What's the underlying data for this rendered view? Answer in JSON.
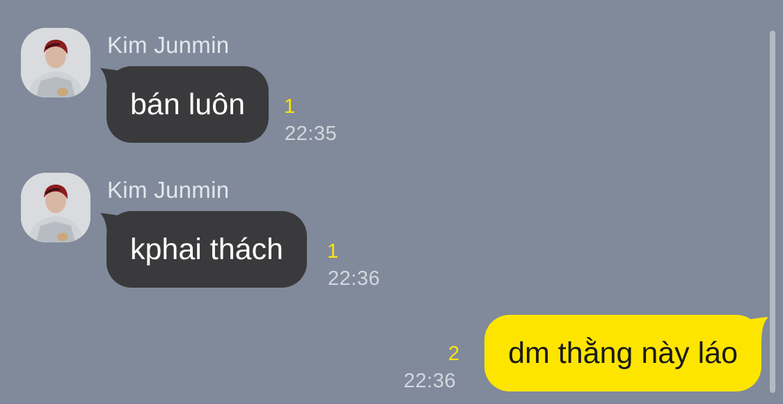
{
  "messages": [
    {
      "sender": "Kim Junmin",
      "text": "bán luôn",
      "unread": "1",
      "time": "22:35",
      "direction": "incoming"
    },
    {
      "sender": "Kim Junmin",
      "text": "kphai thách",
      "unread": "1",
      "time": "22:36",
      "direction": "incoming"
    },
    {
      "sender": "",
      "text": "dm thằng này láo",
      "unread": "2",
      "time": "22:36",
      "direction": "outgoing"
    }
  ],
  "colors": {
    "background": "#808a9b",
    "incoming_bubble": "#3a3a3c",
    "outgoing_bubble": "#fee500",
    "unread_count": "#fee500"
  }
}
